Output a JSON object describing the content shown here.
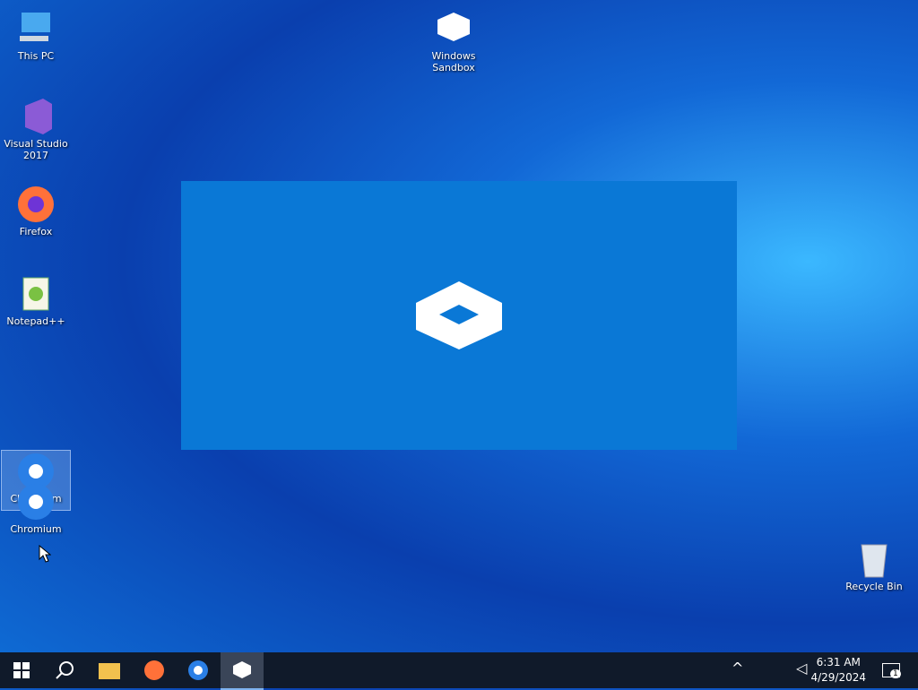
{
  "desktop": {
    "icons": [
      {
        "label": "This PC"
      },
      {
        "label": "Visual Studio 2017"
      },
      {
        "label": "Firefox"
      },
      {
        "label": "Notepad++"
      },
      {
        "label": "Chromium"
      },
      {
        "label": "Chromium"
      },
      {
        "label": "Windows Sandbox"
      },
      {
        "label": "Recycle Bin"
      }
    ]
  },
  "taskbar": {
    "time": "6:31 AM",
    "date": "4/29/2024",
    "notification_count": "1"
  }
}
